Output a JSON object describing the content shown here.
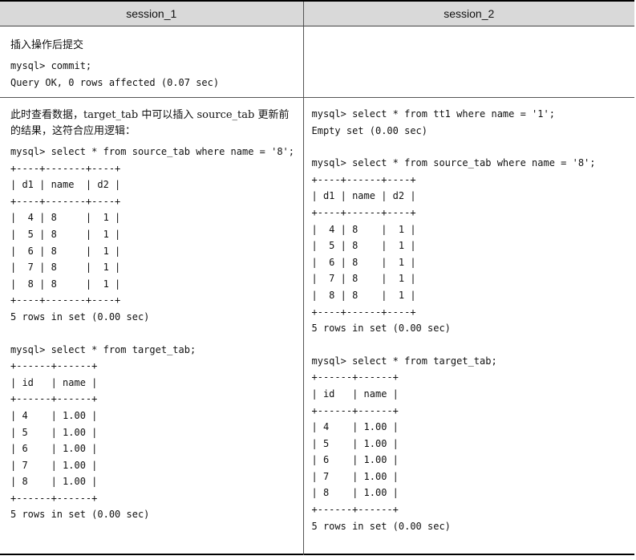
{
  "headers": {
    "session1": "session_1",
    "session2": "session_2"
  },
  "row1": {
    "note": "插入操作后提交",
    "commands": [
      "mysql> commit;",
      "Query OK, 0 rows affected (0.07 sec)"
    ]
  },
  "row2": {
    "left": {
      "note": "此时查看数据，target_tab 中可以插入 source_tab 更新前的结果，这符合应用逻辑：",
      "query1": "mysql> select * from source_tab where name = '8';",
      "table1": [
        "+----+-------+----+",
        "| d1 | name  | d2 |",
        "+----+-------+----+",
        "|  4 | 8     |  1 |",
        "|  5 | 8     |  1 |",
        "|  6 | 8     |  1 |",
        "|  7 | 8     |  1 |",
        "|  8 | 8     |  1 |",
        "+----+-------+----+"
      ],
      "result1": "5 rows in set (0.00 sec)",
      "query2": "mysql> select * from target_tab;",
      "table2": [
        "+------+------+",
        "| id   | name |",
        "+------+------+",
        "| 4    | 1.00 |",
        "| 5    | 1.00 |",
        "| 6    | 1.00 |",
        "| 7    | 1.00 |",
        "| 8    | 1.00 |",
        "+------+------+"
      ],
      "result2": "5 rows in set (0.00 sec)"
    },
    "right": {
      "query0": "mysql> select * from tt1 where name = '1';",
      "result0": "Empty set (0.00 sec)",
      "query1": "mysql> select * from source_tab where name = '8';",
      "table1": [
        "+----+------+----+",
        "| d1 | name | d2 |",
        "+----+------+----+",
        "|  4 | 8    |  1 |",
        "|  5 | 8    |  1 |",
        "|  6 | 8    |  1 |",
        "|  7 | 8    |  1 |",
        "|  8 | 8    |  1 |",
        "+----+------+----+"
      ],
      "result1": "5 rows in set (0.00 sec)",
      "query2": "mysql> select * from target_tab;",
      "table2": [
        "+------+------+",
        "| id   | name |",
        "+------+------+",
        "| 4    | 1.00 |",
        "| 5    | 1.00 |",
        "| 6    | 1.00 |",
        "| 7    | 1.00 |",
        "| 8    | 1.00 |",
        "+------+------+"
      ],
      "result2": "5 rows in set (0.00 sec)"
    }
  }
}
